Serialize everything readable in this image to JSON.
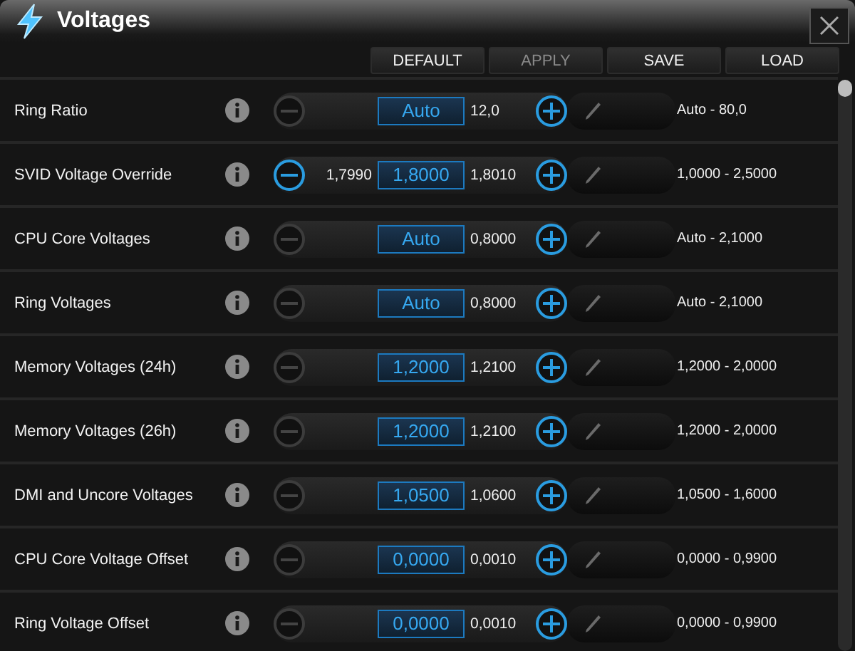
{
  "window": {
    "title": "Voltages"
  },
  "toolbar": [
    {
      "label": "DEFAULT",
      "disabled": false
    },
    {
      "label": "APPLY",
      "disabled": true
    },
    {
      "label": "SAVE",
      "disabled": false
    },
    {
      "label": "LOAD",
      "disabled": false
    }
  ],
  "rows": [
    {
      "label": "Ring Ratio",
      "minus_enabled": false,
      "value": "Auto",
      "next": "12,0",
      "range": "Auto - 80,0"
    },
    {
      "label": "SVID Voltage Override",
      "minus_enabled": true,
      "previous": "1,7990",
      "value": "1,8000",
      "next": "1,8010",
      "range": "1,0000 - 2,5000"
    },
    {
      "label": "CPU Core Voltages",
      "minus_enabled": false,
      "value": "Auto",
      "next": "0,8000",
      "range": "Auto - 2,1000"
    },
    {
      "label": "Ring Voltages",
      "minus_enabled": false,
      "value": "Auto",
      "next": "0,8000",
      "range": "Auto - 2,1000"
    },
    {
      "label": "Memory Voltages (24h)",
      "minus_enabled": false,
      "value": "1,2000",
      "next": "1,2100",
      "range": "1,2000 - 2,0000"
    },
    {
      "label": "Memory Voltages (26h)",
      "minus_enabled": false,
      "value": "1,2000",
      "next": "1,2100",
      "range": "1,2000 - 2,0000"
    },
    {
      "label": "DMI and Uncore Voltages",
      "minus_enabled": false,
      "value": "1,0500",
      "next": "1,0600",
      "range": "1,0500 - 1,6000"
    },
    {
      "label": "CPU Core Voltage Offset",
      "minus_enabled": false,
      "value": "0,0000",
      "next": "0,0010",
      "range": "0,0000 - 0,9900"
    },
    {
      "label": "Ring Voltage Offset",
      "minus_enabled": false,
      "value": "0,0000",
      "next": "0,0010",
      "range": "0,0000 - 0,9900"
    }
  ]
}
